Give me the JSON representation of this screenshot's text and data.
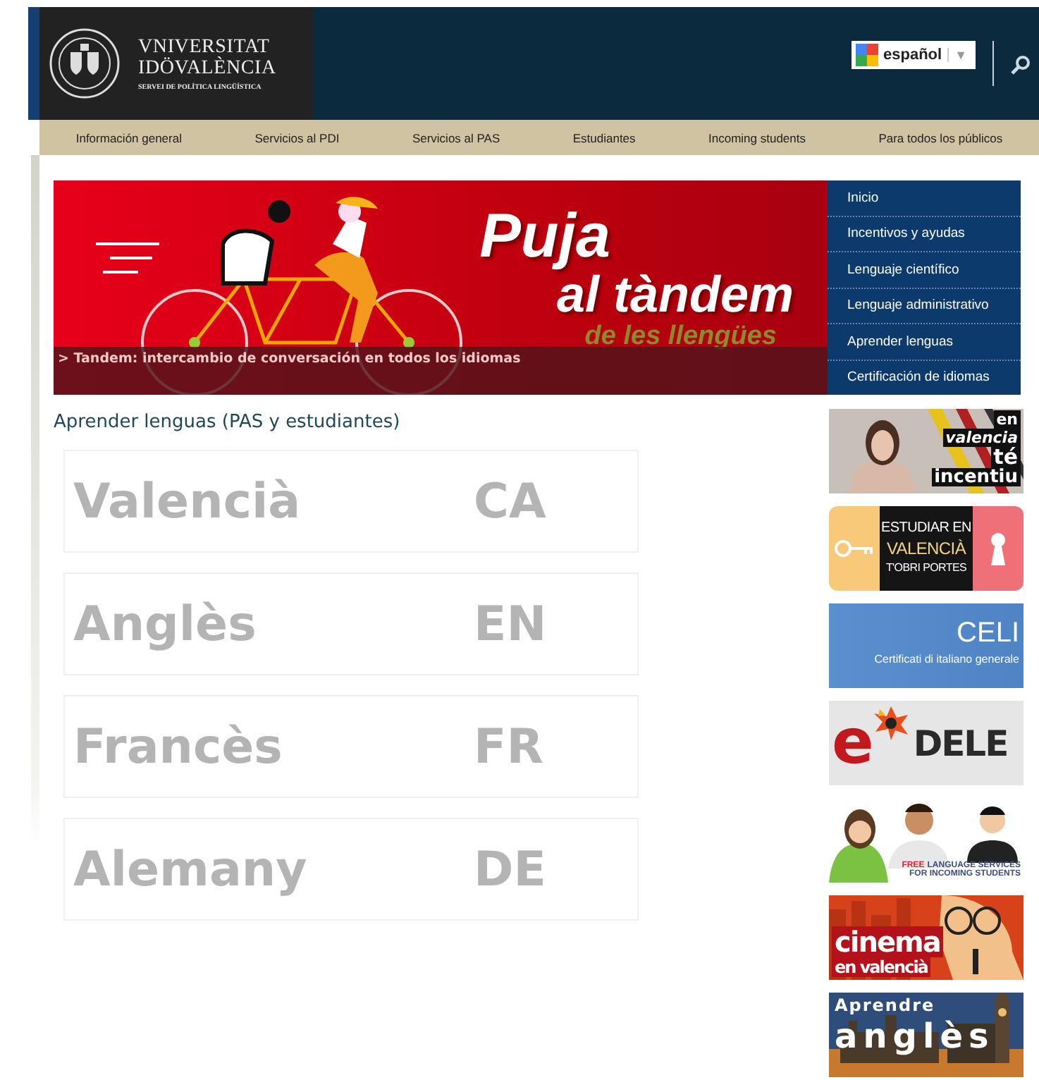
{
  "header": {
    "logo": {
      "line1": "VNIVERSITAT",
      "line2": "IDÖVALÈNCIA",
      "subtitle": "SERVEI DE POLÍTICA LINGÜÍSTICA"
    },
    "language": {
      "value": "español",
      "arrow": "▼"
    }
  },
  "nav": [
    "Información general",
    "Servicios al PDI",
    "Servicios al PAS",
    "Estudiantes",
    "Incoming students",
    "Para todos los públicos"
  ],
  "banner": {
    "title": "Puja",
    "subtitle": "al tàndem",
    "tagline": "de les llengües",
    "caption": "> Tandem: intercambio de conversación en todos los idiomas"
  },
  "side_menu": [
    "Inicio",
    "Incentivos y ayudas",
    "Lenguaje científico",
    "Lenguaje administrativo",
    "Aprender lenguas",
    "Certificación de idiomas"
  ],
  "heading": "Aprender lenguas (PAS y estudiantes)",
  "languages": [
    {
      "name": "Valencià",
      "code": "CA"
    },
    {
      "name": "Anglès",
      "code": "EN"
    },
    {
      "name": "Francès",
      "code": "FR"
    },
    {
      "name": "Alemany",
      "code": "DE"
    }
  ],
  "promos": [
    {
      "kind": "incentiu",
      "texts": [
        "en",
        "valencia",
        "té",
        "incentiu"
      ]
    },
    {
      "kind": "keys",
      "texts": [
        "ESTUDIAR EN",
        "VALENCIÀ",
        "T'OBRI PORTES"
      ]
    },
    {
      "kind": "celi",
      "texts": [
        "CELI",
        "Certificati di italiano generale"
      ]
    },
    {
      "kind": "dele",
      "texts": [
        "e",
        "DELE"
      ]
    },
    {
      "kind": "students",
      "texts": [
        "FREE",
        "LANGUAGE SERVICES",
        "FOR INCOMING STUDENTS"
      ]
    },
    {
      "kind": "cinema",
      "texts": [
        "cinema",
        "en valencià"
      ]
    },
    {
      "kind": "angles",
      "texts": [
        "Aprendre",
        "anglès"
      ]
    }
  ]
}
